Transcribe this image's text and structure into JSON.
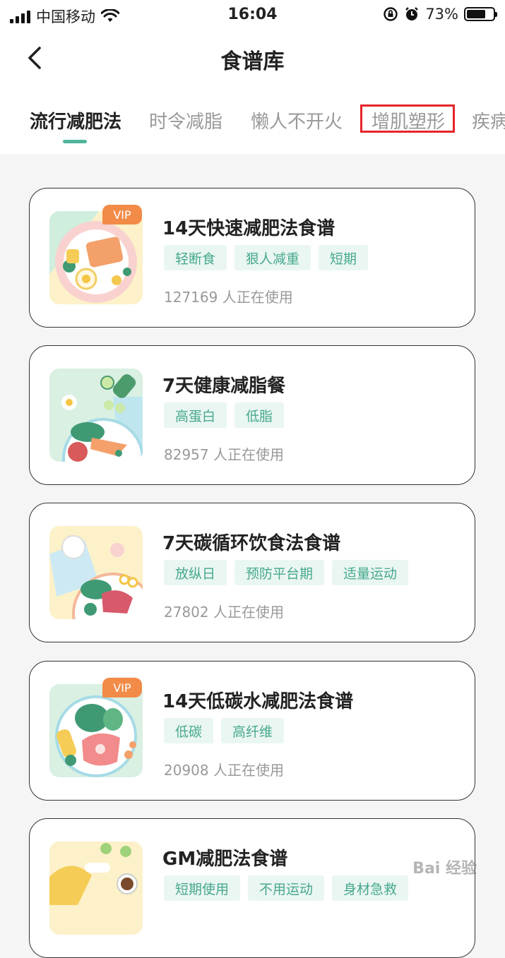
{
  "status_bar": {
    "carrier": "中国移动",
    "time": "16:04",
    "battery": "73%",
    "battery_level": 0.73
  },
  "header": {
    "title": "食谱库",
    "back_icon": "chevron-left-icon"
  },
  "tabs": [
    {
      "label": "流行减肥法",
      "active": true
    },
    {
      "label": "时令减脂",
      "active": false
    },
    {
      "label": "懒人不开火",
      "active": false
    },
    {
      "label": "增肌塑形",
      "active": false,
      "highlighted": true
    },
    {
      "label": "疾病",
      "active": false
    }
  ],
  "colors": {
    "accent": "#4fb59c",
    "tag_bg": "#eaf6f2",
    "tag_text": "#46a88e",
    "vip": "#f28b48",
    "highlight": "#e5252a"
  },
  "recipes": [
    {
      "title": "14天快速减肥法食谱",
      "vip": "VIP",
      "tags": [
        "轻断食",
        "狠人减重",
        "短期"
      ],
      "users": "127169 人正在使用"
    },
    {
      "title": "7天健康减脂餐",
      "tags": [
        "高蛋白",
        "低脂"
      ],
      "users": "82957 人正在使用"
    },
    {
      "title": "7天碳循环饮食法食谱",
      "tags": [
        "放纵日",
        "预防平台期",
        "适量运动"
      ],
      "users": "27802 人正在使用"
    },
    {
      "title": "14天低碳水减肥法食谱",
      "vip": "VIP",
      "tags": [
        "低碳",
        "高纤维"
      ],
      "users": "20908 人正在使用"
    },
    {
      "title": "GM减肥法食谱",
      "tags": [
        "短期使用",
        "不用运动",
        "身材急救"
      ],
      "users": ""
    }
  ],
  "watermark": "Bai 经验"
}
